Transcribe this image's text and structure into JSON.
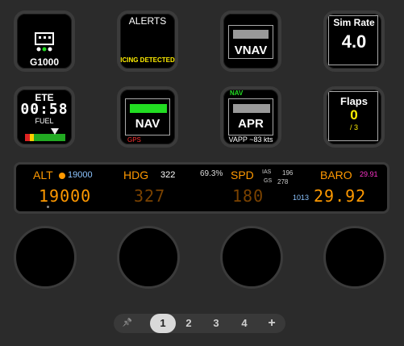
{
  "keys": {
    "g1000": {
      "label": "G1000"
    },
    "alerts": {
      "title": "ALERTS",
      "message": "ICING DETECTED"
    },
    "vnav": {
      "label": "VNAV"
    },
    "simrate": {
      "title": "Sim Rate",
      "value": "4.0"
    },
    "ete": {
      "title": "ETE",
      "time": "00:58",
      "fuel_label": "FUEL"
    },
    "nav": {
      "label": "NAV",
      "source": "GPS"
    },
    "apr": {
      "top": "NAV",
      "label": "APR",
      "sub": "VAPP ~83 kts"
    },
    "flaps": {
      "title": "Flaps",
      "value": "0",
      "total": "/ 3"
    }
  },
  "strip": {
    "alt_label": "ALT",
    "alt_bug": "19000",
    "alt_value": "19000",
    "hdg_label": "HDG",
    "hdg_bug": "322",
    "hdg_value": "327",
    "spd_pct": "69.3%",
    "spd_label": "SPD",
    "ias_label": "IAS",
    "ias_value": "196",
    "gs_label": "GS",
    "gs_value": "278",
    "spd_value": "180",
    "baro_label": "BARO",
    "baro_setting": "29.91",
    "baro_hpa": "1013",
    "baro_value": "29.92"
  },
  "pager": {
    "pin": "📌",
    "pages": [
      "1",
      "2",
      "3",
      "4"
    ],
    "add": "+",
    "selected": "1"
  },
  "colors": {
    "amber": "#ff9900",
    "green": "#22dd22",
    "magenta": "#ff33cc",
    "yellow": "#ffee00"
  }
}
